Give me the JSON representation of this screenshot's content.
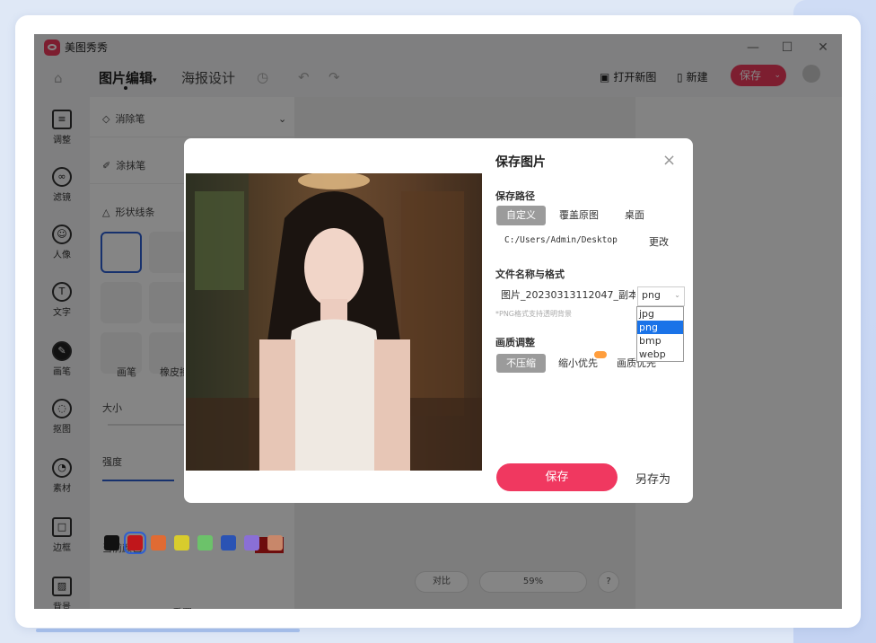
{
  "app": {
    "title": "美图秀秀"
  },
  "toolbar": {
    "tabs": [
      "图片编辑",
      "海报设计"
    ],
    "open_new": "打开新图",
    "new": "新建",
    "save": "保存"
  },
  "left_nav": [
    {
      "label": "调整",
      "icon": "sliders-icon"
    },
    {
      "label": "滤镜",
      "icon": "filter-icon"
    },
    {
      "label": "人像",
      "icon": "portrait-icon"
    },
    {
      "label": "文字",
      "icon": "text-icon"
    },
    {
      "label": "画笔",
      "icon": "brush-icon",
      "active": true
    },
    {
      "label": "抠图",
      "icon": "cutout-icon"
    },
    {
      "label": "素材",
      "icon": "sticker-icon"
    },
    {
      "label": "边框",
      "icon": "border-icon"
    },
    {
      "label": "背景",
      "icon": "background-icon"
    }
  ],
  "panel": {
    "eraser": "消除笔",
    "paint": "涂抹笔",
    "shape_lines": "形状线条",
    "brush_tab": "画笔",
    "eraser_tab": "橡皮擦",
    "size": "大小",
    "strength": "强度",
    "current_color": "当前颜色",
    "reset": "重置",
    "current_color_value": "#d11a1a",
    "swatches": [
      "#111111",
      "#c0161b",
      "#e06b33",
      "#d8cc2d",
      "#6cc26a",
      "#2a53b4",
      "#8a6fd6",
      "#c8876a"
    ]
  },
  "canvas_controls": {
    "compare": "对比",
    "zoom": "59%"
  },
  "dialog": {
    "title": "保存图片",
    "close": "×",
    "save_path_label": "保存路径",
    "path_options": [
      "自定义",
      "覆盖原图",
      "桌面"
    ],
    "path_value": "C:/Users/Admin/Desktop",
    "change_button": "更改",
    "filename_label": "文件名称与格式",
    "filename_value": "图片_20230313112047_副本",
    "format_value": "png",
    "format_options": [
      "jpg",
      "png",
      "bmp",
      "webp"
    ],
    "png_hint": "*PNG格式支持透明背景",
    "quality_label": "画质调整",
    "quality_options": [
      "不压缩",
      "缩小优先",
      "画质优先"
    ],
    "save_button": "保存",
    "save_as_button": "另存为"
  }
}
